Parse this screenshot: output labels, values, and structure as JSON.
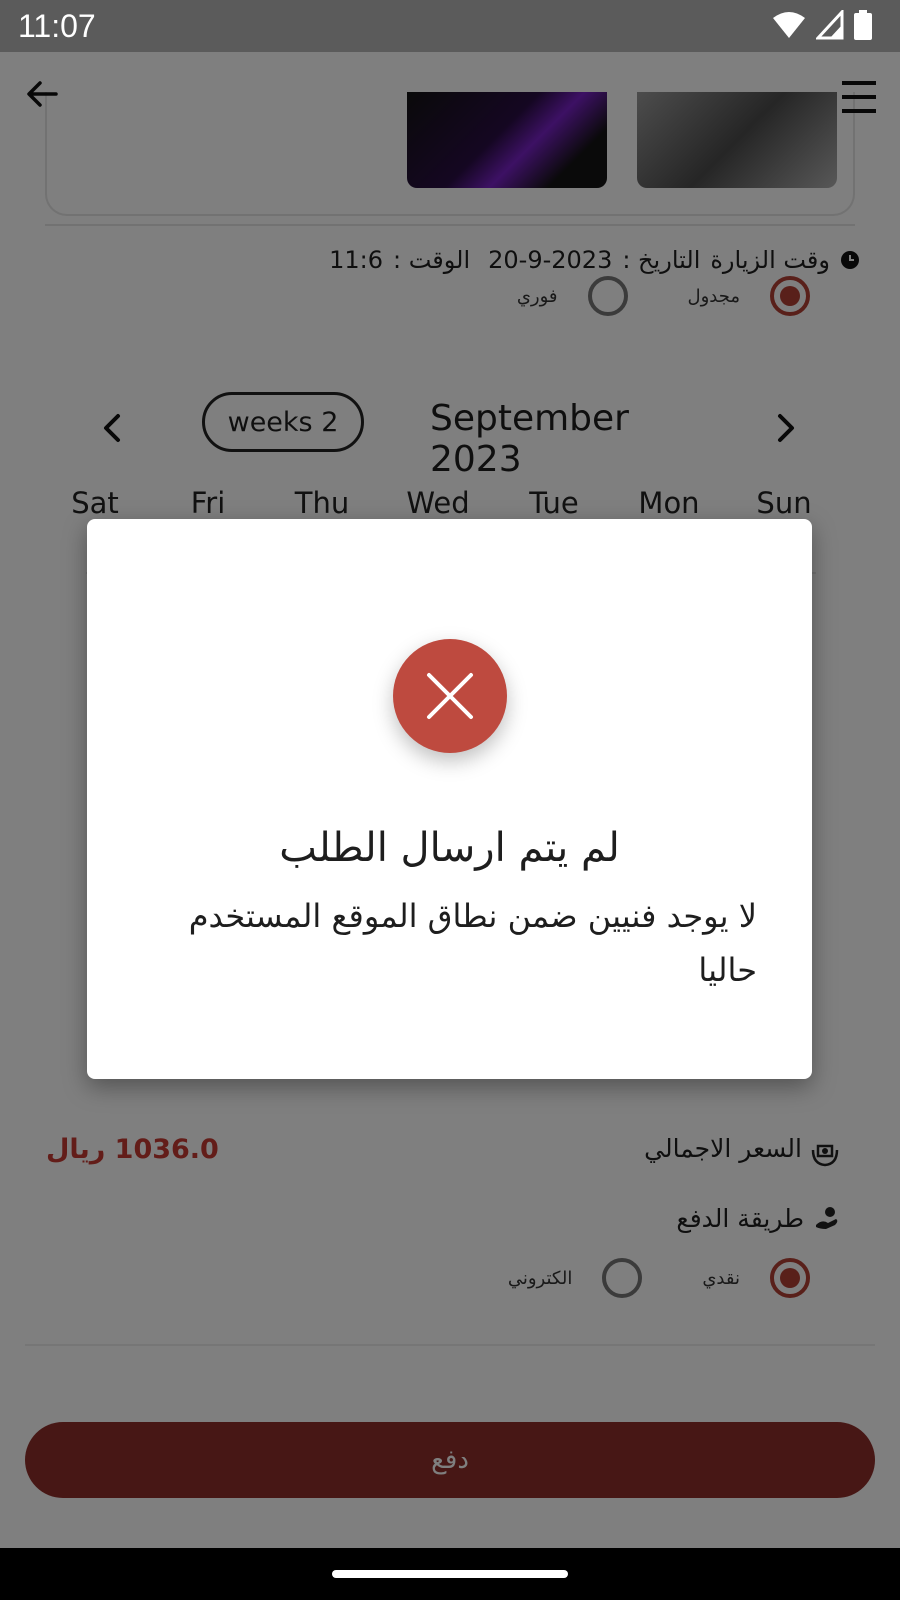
{
  "status_bar": {
    "time": "11:07",
    "icons": [
      "wifi-icon",
      "signal-icon",
      "battery-icon"
    ]
  },
  "header": {
    "back_icon": "arrow-left-icon",
    "menu_icon": "hamburger-menu-icon"
  },
  "visit": {
    "label": "وقت الزيارة",
    "date_label": "التاريخ :",
    "date_value": "20-9-2023",
    "time_label": "الوقت :",
    "time_value": "11:6"
  },
  "schedule_type": {
    "options": [
      {
        "label": "مجدول",
        "selected": true
      },
      {
        "label": "فوري",
        "selected": false
      }
    ]
  },
  "calendar": {
    "month": "September 2023",
    "weeks_label": "weeks 2",
    "weekdays": [
      "Sun",
      "Mon",
      "Tue",
      "Wed",
      "Thu",
      "Fri",
      "Sat"
    ]
  },
  "summary": {
    "total_label": "السعر الاجمالي",
    "total_value": "1036.0 ريال",
    "payment_method_label": "طريقة الدفع"
  },
  "payment_options": [
    {
      "label": "نقدي",
      "selected": true
    },
    {
      "label": "الكتروني",
      "selected": false
    }
  ],
  "pay_button": {
    "label": "دفع"
  },
  "dialog": {
    "title": "لم يتم ارسال الطلب",
    "message": "لا يوجد فنيين ضمن نطاق الموقع المستخدم حاليا",
    "icon": "error-x-icon"
  },
  "colors": {
    "accent": "#b24135",
    "price": "#c63a33",
    "pay_button": "#8e2f2b",
    "error": "#be4a3f"
  }
}
